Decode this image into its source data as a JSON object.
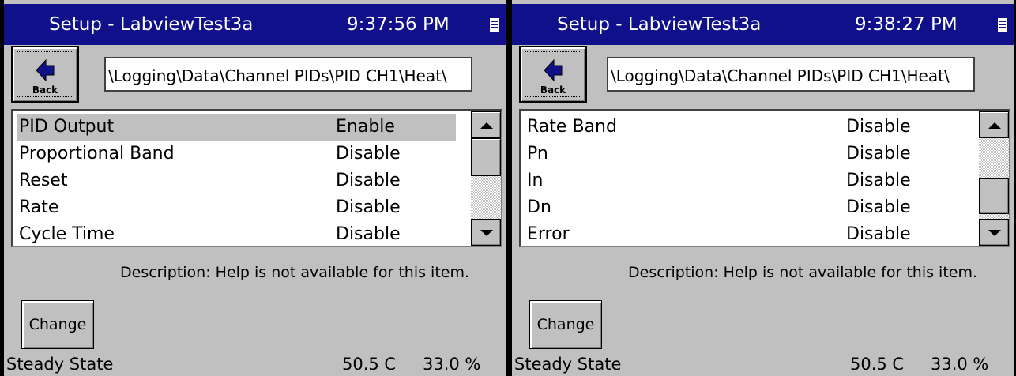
{
  "panels": [
    {
      "title": "Setup - LabviewTest3a",
      "time": "9:37:56 PM",
      "back_label": "Back",
      "path": "\\Logging\\Data\\Channel PIDs\\PID CH1\\Heat\\",
      "rows": [
        {
          "name": "PID Output",
          "value": "Enable"
        },
        {
          "name": "Proportional Band",
          "value": "Disable"
        },
        {
          "name": "Reset",
          "value": "Disable"
        },
        {
          "name": "Rate",
          "value": "Disable"
        },
        {
          "name": "Cycle Time",
          "value": "Disable"
        }
      ],
      "description": "Description:  Help is not available for this item.",
      "change_label": "Change",
      "status": {
        "state": "Steady State",
        "temp": "50.5 C",
        "percent": "33.0 %"
      }
    },
    {
      "title": "Setup - LabviewTest3a",
      "time": "9:38:27 PM",
      "back_label": "Back",
      "path": "\\Logging\\Data\\Channel PIDs\\PID CH1\\Heat\\",
      "rows": [
        {
          "name": "Rate Band",
          "value": "Disable"
        },
        {
          "name": "Pn",
          "value": "Disable"
        },
        {
          "name": "In",
          "value": "Disable"
        },
        {
          "name": "Dn",
          "value": "Disable"
        },
        {
          "name": "Error",
          "value": "Disable"
        }
      ],
      "description": "Description:  Help is not available for this item.",
      "change_label": "Change",
      "status": {
        "state": "Steady State",
        "temp": "50.5 C",
        "percent": "33.0 %"
      }
    }
  ]
}
